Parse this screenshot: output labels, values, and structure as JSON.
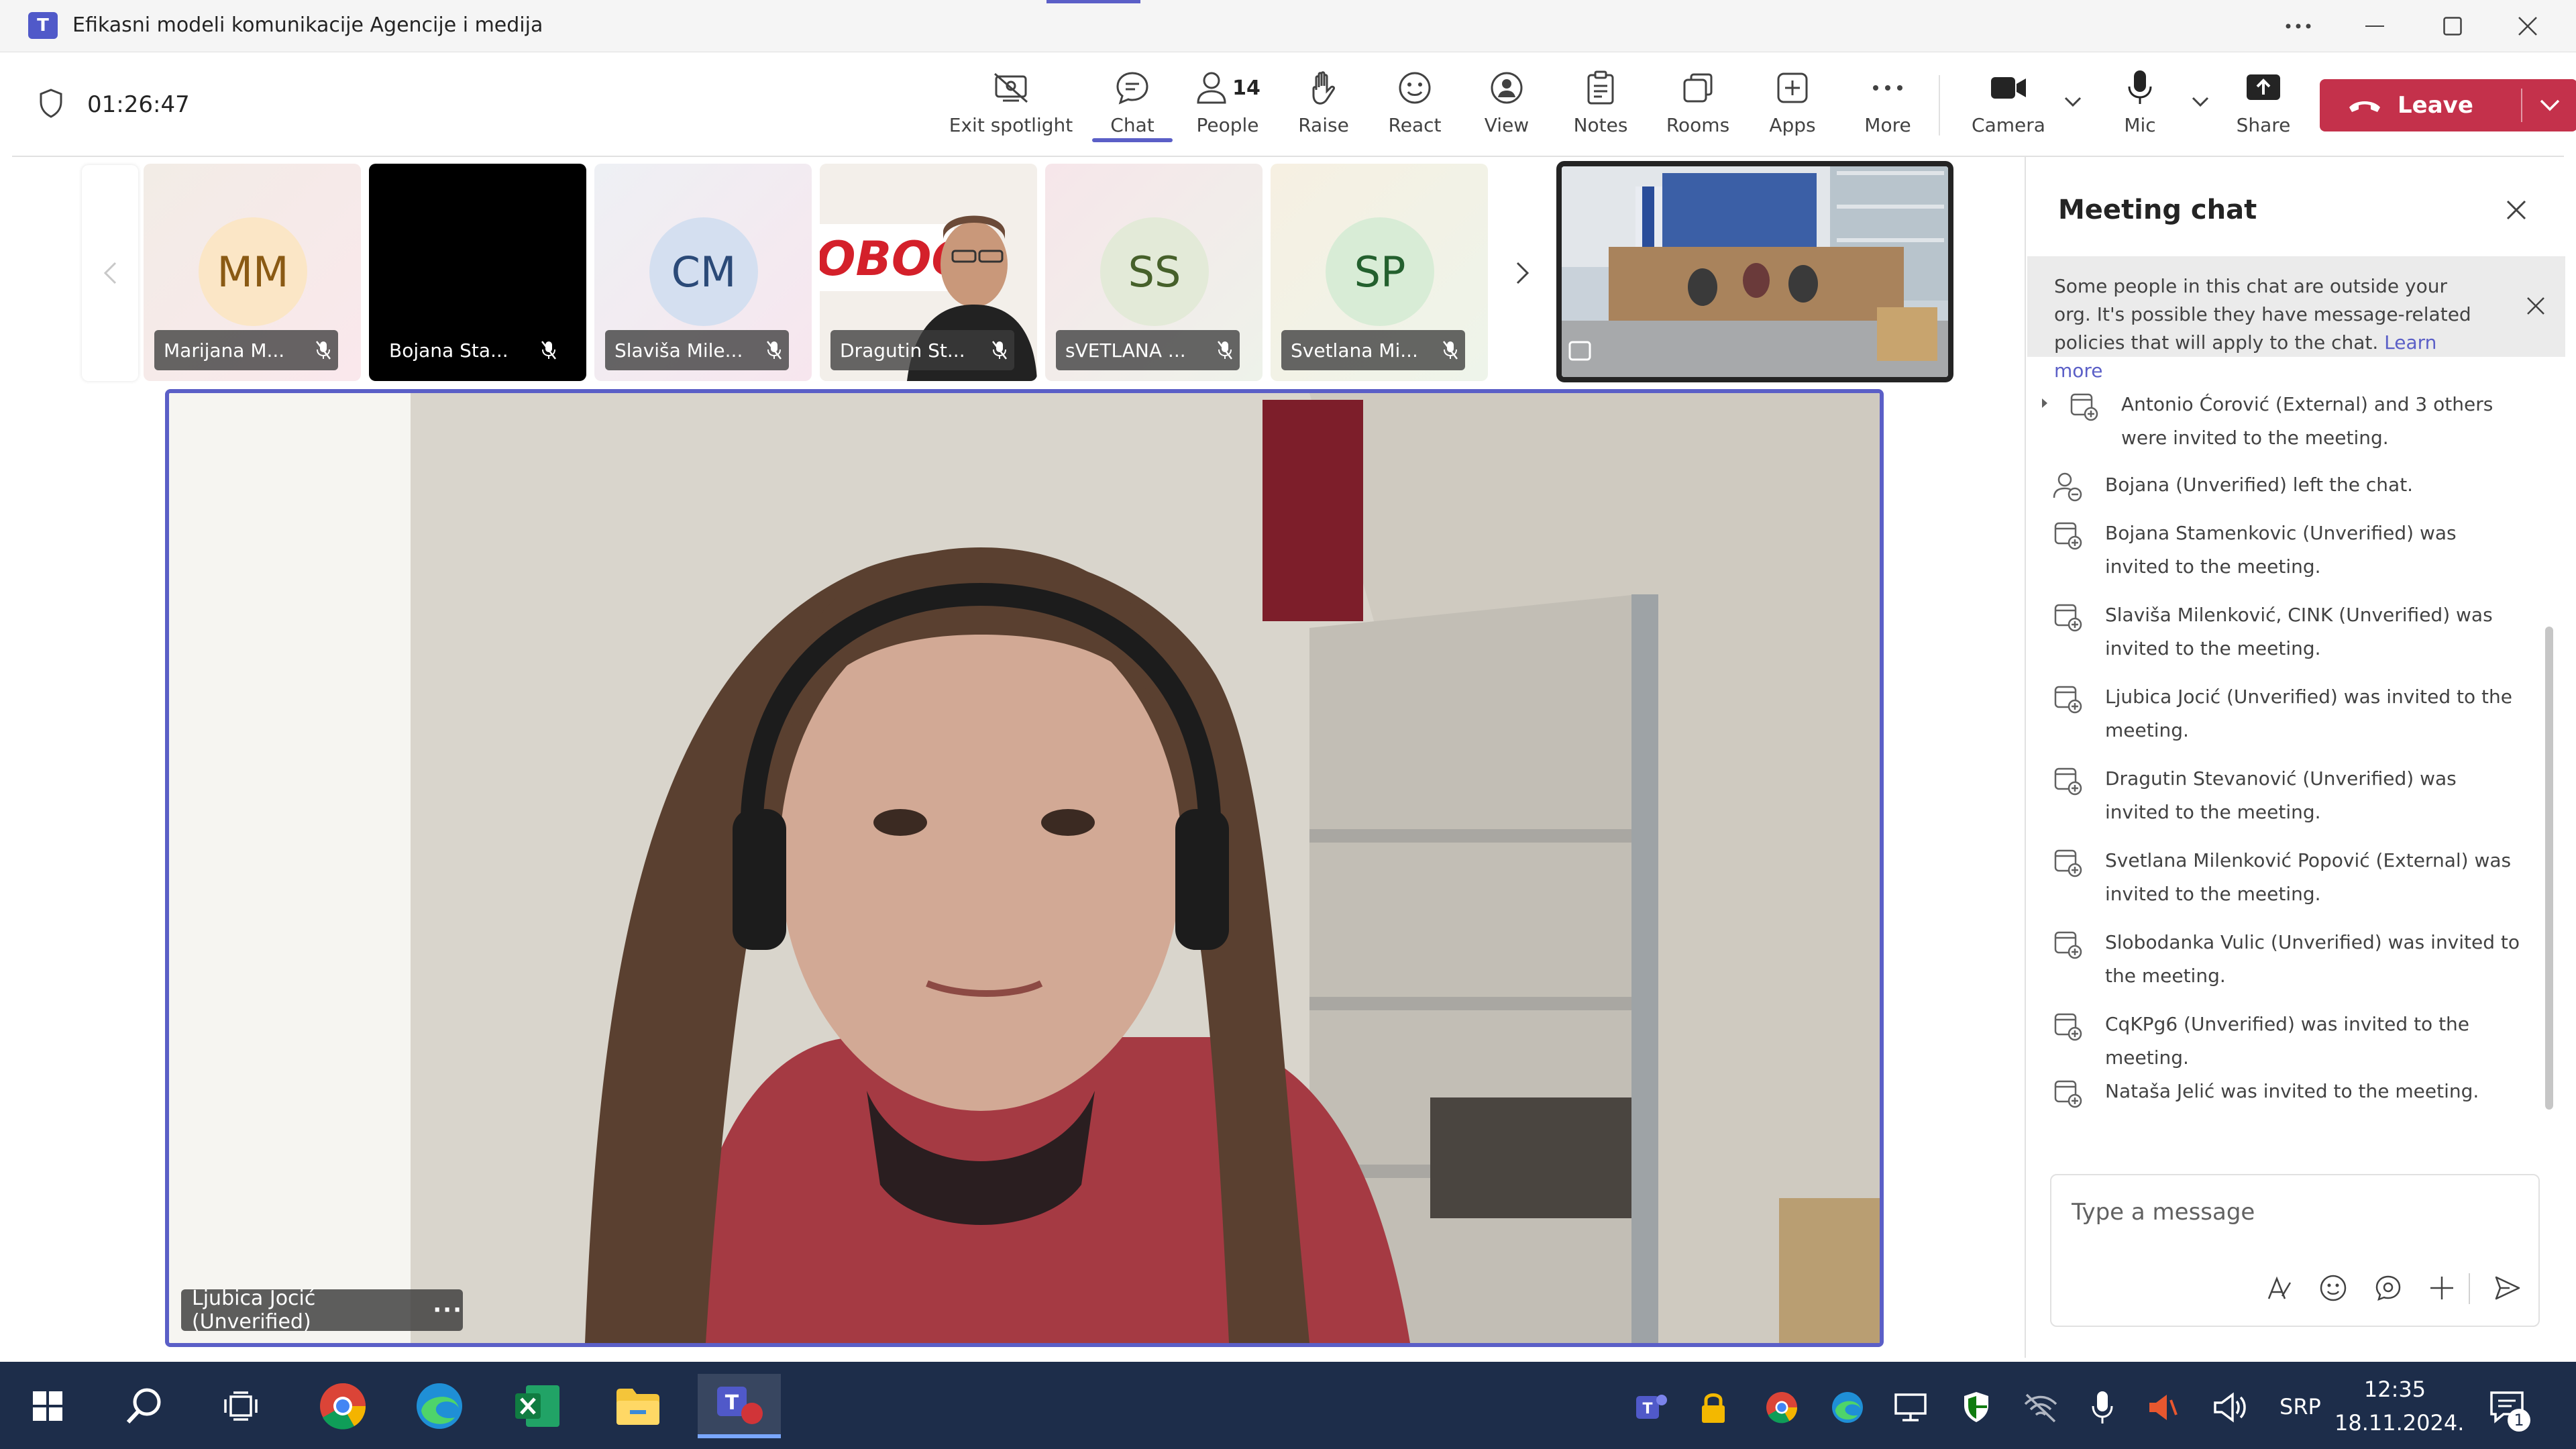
{
  "window": {
    "title": "Efikasni modeli komunikacije Agencije i medija"
  },
  "meeting": {
    "timer": "01:26:47"
  },
  "toolbar": {
    "exit_spotlight": "Exit spotlight",
    "chat": "Chat",
    "people": "People",
    "people_count": "14",
    "raise": "Raise",
    "react": "React",
    "view": "View",
    "notes": "Notes",
    "rooms": "Rooms",
    "apps": "Apps",
    "more": "More",
    "camera": "Camera",
    "mic": "Mic",
    "share": "Share",
    "leave": "Leave"
  },
  "participants": [
    {
      "initials": "MM",
      "name": "Marijana M..."
    },
    {
      "initials": "",
      "name": "Bojana Sta..."
    },
    {
      "initials": "CM",
      "name": "Slaviša Mile..."
    },
    {
      "initials": "",
      "name": "Dragutin St..."
    },
    {
      "initials": "SS",
      "name": "sVETLANA ..."
    },
    {
      "initials": "SP",
      "name": "Svetlana Mi..."
    }
  ],
  "video_overlay_text": "OBOCT",
  "spotlight": {
    "name": "Ljubica Jocić (Unverified)",
    "more": "···"
  },
  "chat": {
    "title": "Meeting chat",
    "banner_text": "Some people in this chat are outside your org. It's possible they have message-related policies that will apply to the chat.",
    "banner_link": "Learn more",
    "messages": [
      "Antonio Ćorović (External) and 3 others were invited to the meeting.",
      "Bojana (Unverified) left the chat.",
      "Bojana Stamenkovic (Unverified) was invited to the meeting.",
      "Slaviša Milenković, CINK (Unverified) was invited to the meeting.",
      "Ljubica Jocić (Unverified) was invited to the meeting.",
      "Dragutin Stevanović (Unverified) was invited to the meeting.",
      "Svetlana Milenković Popović (External) was invited to the meeting.",
      "Slobodanka Vulic (Unverified) was invited to the meeting.",
      "CqKPg6 (Unverified) was invited to the meeting.",
      "Nataša Jelić was invited to the meeting."
    ],
    "composer_placeholder": "Type a message"
  },
  "taskbar": {
    "lang": "SRP",
    "time": "12:35",
    "date": "18.11.2024.",
    "notifications": "1"
  },
  "colors": {
    "accent": "#5b5fc7",
    "leave": "#c4314b",
    "taskbar": "#1d2d4a"
  }
}
